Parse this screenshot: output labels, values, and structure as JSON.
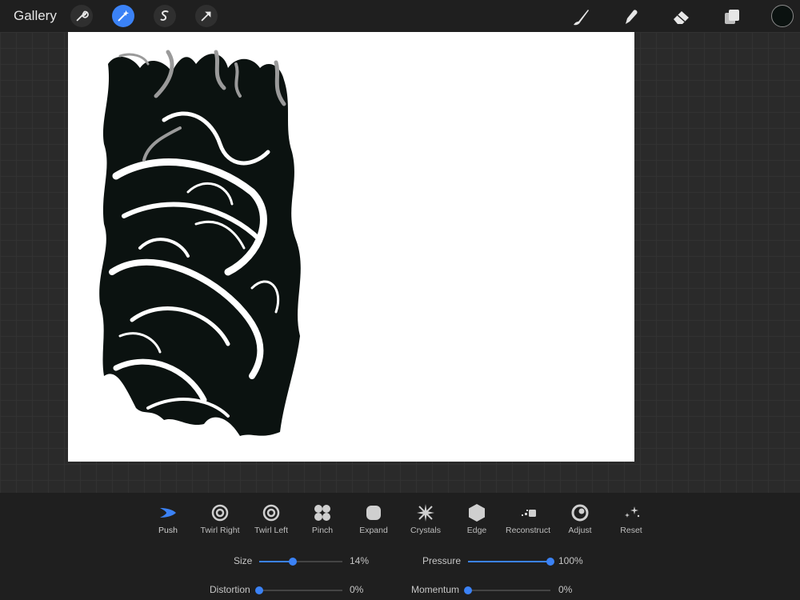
{
  "topbar": {
    "gallery_label": "Gallery",
    "left_tools": [
      "wrench-icon",
      "magic-wand-icon",
      "selection-icon",
      "transform-arrow-icon"
    ],
    "active_tool": "magic-wand-icon",
    "right_tools": [
      "brush-icon",
      "smudge-icon",
      "eraser-icon",
      "layers-icon"
    ],
    "current_color": "#0b1210"
  },
  "liquify": {
    "active_mode": "Push",
    "modes": [
      {
        "label": "Push",
        "icon": "push-icon"
      },
      {
        "label": "Twirl Right",
        "icon": "twirl-right-icon"
      },
      {
        "label": "Twirl Left",
        "icon": "twirl-left-icon"
      },
      {
        "label": "Pinch",
        "icon": "pinch-icon"
      },
      {
        "label": "Expand",
        "icon": "expand-icon"
      },
      {
        "label": "Crystals",
        "icon": "crystals-icon"
      },
      {
        "label": "Edge",
        "icon": "edge-icon"
      },
      {
        "label": "Reconstruct",
        "icon": "reconstruct-icon"
      },
      {
        "label": "Adjust",
        "icon": "adjust-icon"
      },
      {
        "label": "Reset",
        "icon": "reset-icon"
      }
    ],
    "sliders": {
      "size": {
        "label": "Size",
        "value": "14%",
        "fraction": 0.4
      },
      "pressure": {
        "label": "Pressure",
        "value": "100%",
        "fraction": 1.0
      },
      "distortion": {
        "label": "Distortion",
        "value": "0%",
        "fraction": 0.0
      },
      "momentum": {
        "label": "Momentum",
        "value": "0%",
        "fraction": 0.0
      }
    }
  },
  "colors": {
    "accent": "#3b82f6",
    "background": "#2a2a2a",
    "panel": "#1f1f1f",
    "ink": "#0b1210"
  }
}
